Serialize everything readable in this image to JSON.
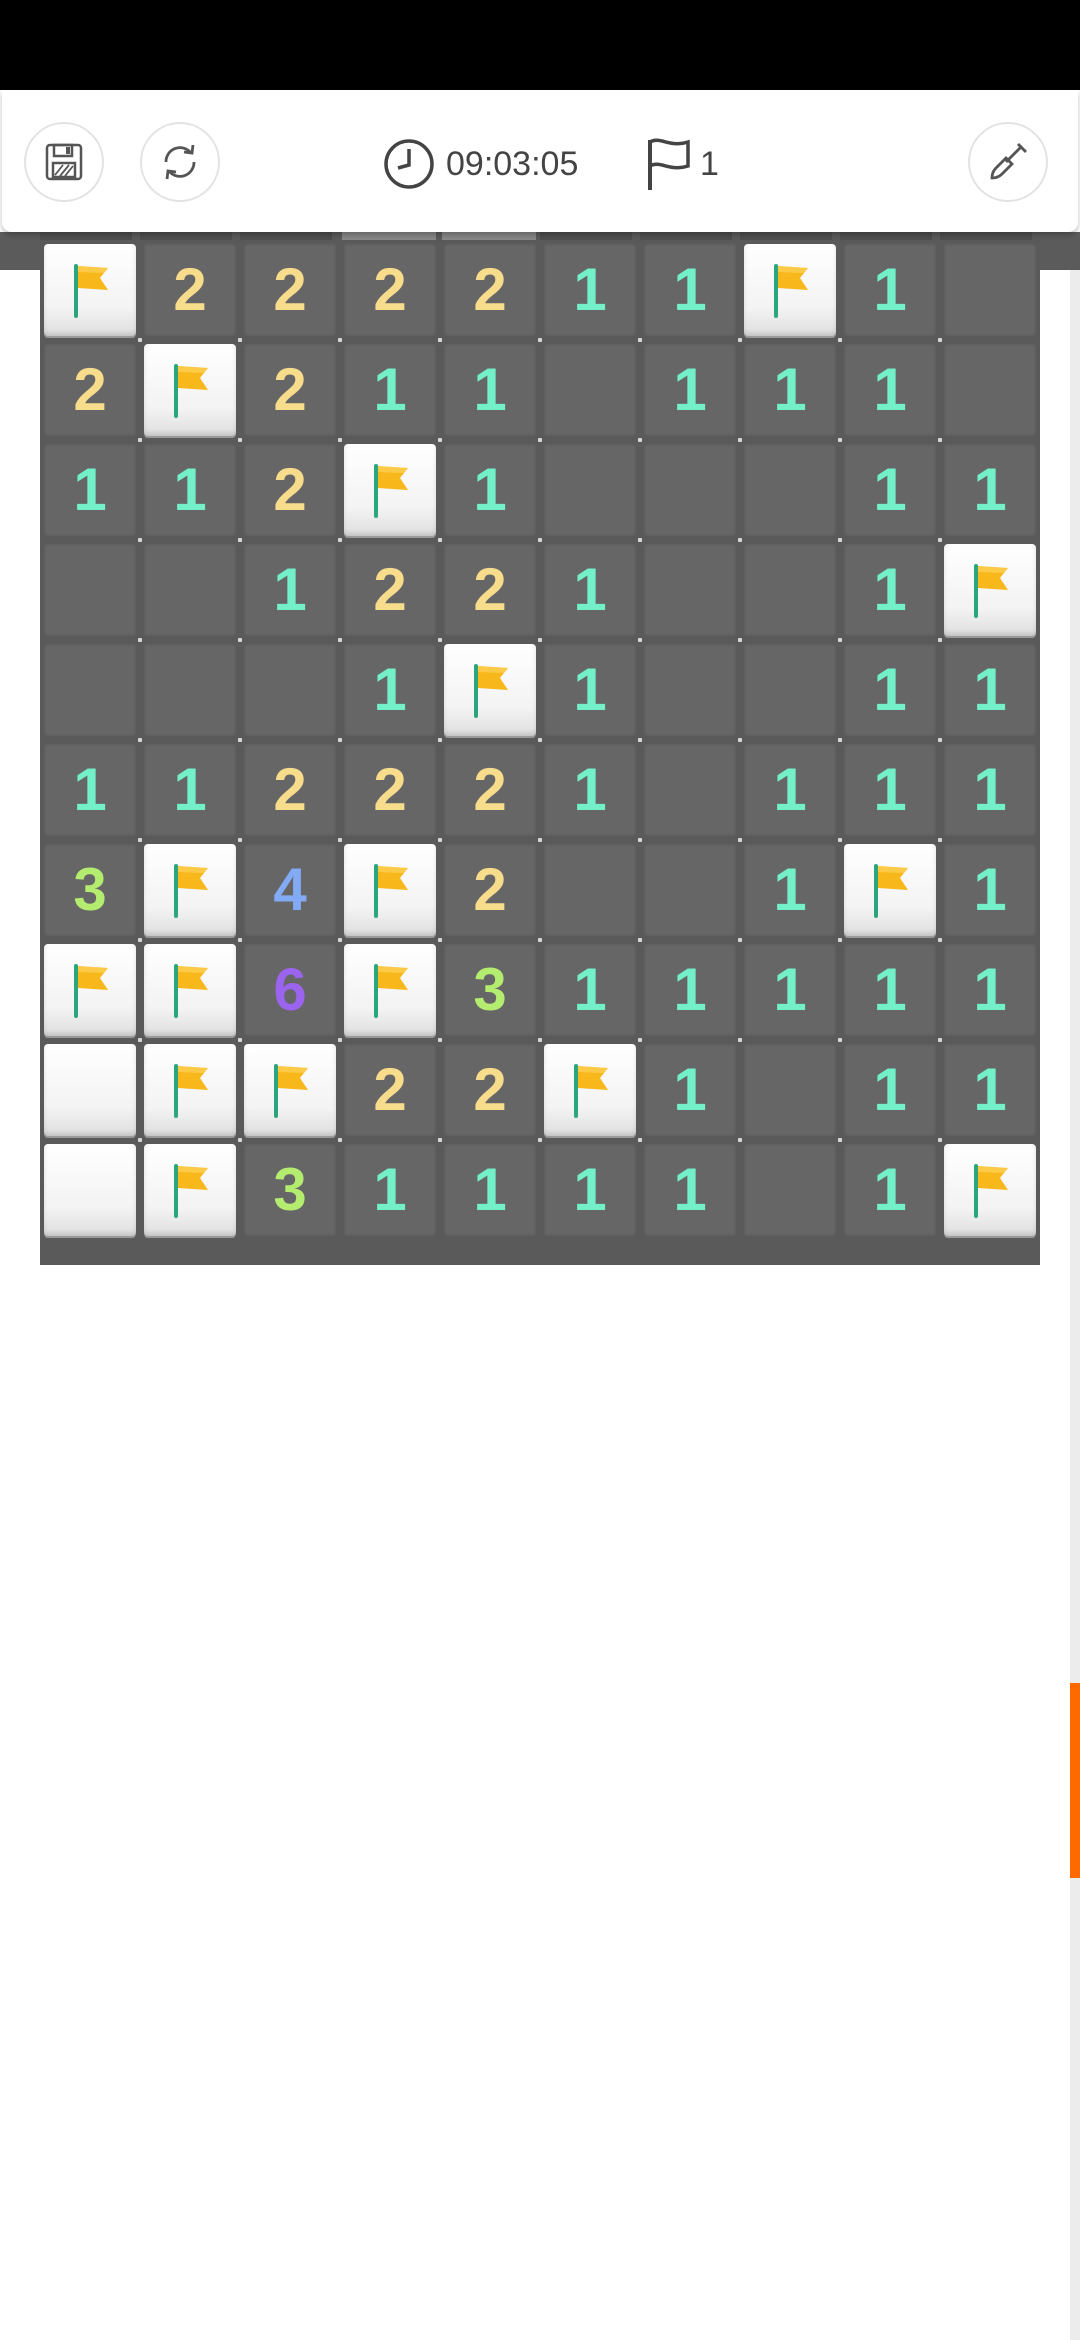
{
  "toolbar": {
    "timer": "09:03:05",
    "flag_count": "1"
  },
  "icons": {
    "save": "save-icon",
    "restart": "restart-icon",
    "clock": "clock-icon",
    "flag": "flag-icon",
    "dig": "shovel-icon"
  },
  "colors": {
    "n1": "#73f0c8",
    "n2": "#f7dc8c",
    "n3": "#b4ec70",
    "n4": "#82aaf5",
    "n6": "#9b64ee",
    "scroll_thumb": "#ff6a00",
    "flag_yellow": "#f8b81c",
    "flag_pole": "#2aa57e"
  },
  "board": {
    "rows": [
      [
        "F",
        "2",
        "2",
        "2",
        "2",
        "1",
        "1",
        "F",
        "1",
        "E"
      ],
      [
        "2",
        "F",
        "2",
        "1",
        "1",
        "E",
        "1",
        "1",
        "1",
        "E"
      ],
      [
        "1",
        "1",
        "2",
        "F",
        "1",
        "E",
        "E",
        "E",
        "1",
        "1"
      ],
      [
        "E",
        "E",
        "1",
        "2",
        "2",
        "1",
        "E",
        "E",
        "1",
        "F"
      ],
      [
        "E",
        "E",
        "E",
        "1",
        "F",
        "1",
        "E",
        "E",
        "1",
        "1"
      ],
      [
        "1",
        "1",
        "2",
        "2",
        "2",
        "1",
        "E",
        "1",
        "1",
        "1"
      ],
      [
        "3",
        "F",
        "4",
        "F",
        "2",
        "E",
        "E",
        "1",
        "F",
        "1"
      ],
      [
        "F",
        "F",
        "6",
        "F",
        "3",
        "1",
        "1",
        "1",
        "1",
        "1"
      ],
      [
        "C",
        "F",
        "F",
        "2",
        "2",
        "F",
        "1",
        "E",
        "1",
        "1"
      ],
      [
        "C",
        "F",
        "3",
        "1",
        "1",
        "1",
        "1",
        "E",
        "1",
        "F"
      ]
    ]
  }
}
